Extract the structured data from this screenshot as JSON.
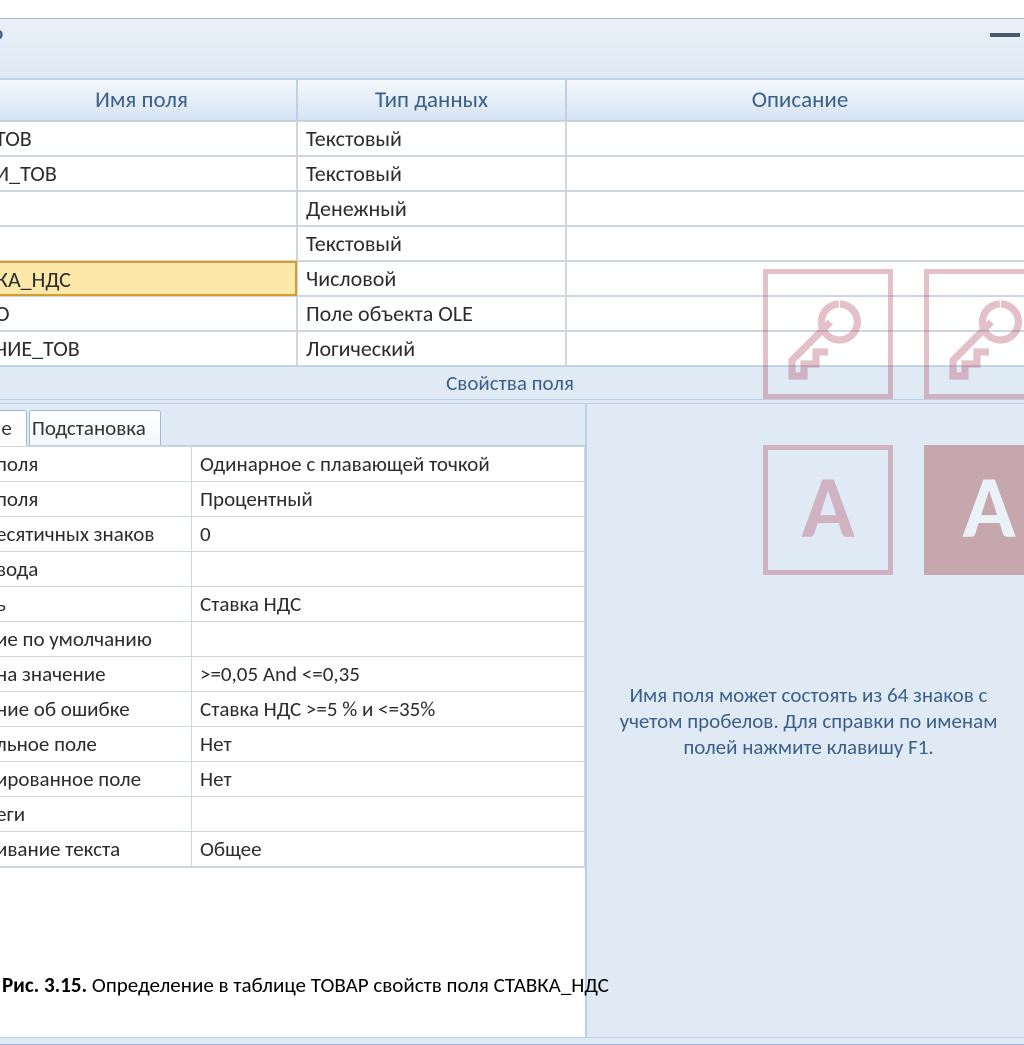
{
  "window": {
    "title_fragment": "Р"
  },
  "grid": {
    "headers": {
      "name": "Имя поля",
      "type": "Тип данных",
      "desc": "Описание"
    },
    "rows": [
      {
        "name": "ТОВ",
        "type": "Текстовый",
        "desc": "",
        "selected": false
      },
      {
        "name": "И_ТОВ",
        "type": "Текстовый",
        "desc": "",
        "selected": false
      },
      {
        "name": "",
        "type": "Денежный",
        "desc": "",
        "selected": false
      },
      {
        "name": "",
        "type": "Текстовый",
        "desc": "",
        "selected": false
      },
      {
        "name": "КА_НДС",
        "type": "Числовой",
        "desc": "",
        "selected": true
      },
      {
        "name": "О",
        "type": "Поле объекта OLE",
        "desc": "",
        "selected": false
      },
      {
        "name": "ЧИЕ_ТОВ",
        "type": "Логический",
        "desc": "",
        "selected": false
      }
    ],
    "separator": "Свойства поля"
  },
  "tabs": {
    "general": "ие",
    "lookup": "Подстановка"
  },
  "properties": [
    {
      "name": "поля",
      "value": "Одинарное с плавающей точкой"
    },
    {
      "name": "поля",
      "value": "Процентный"
    },
    {
      "name": "есятичных знаков",
      "value": "0"
    },
    {
      "name": "вода",
      "value": ""
    },
    {
      "name": "ь",
      "value": "Ставка НДС"
    },
    {
      "name": "ие по умолчанию",
      "value": ""
    },
    {
      "name": "на значение",
      "value": ">=0,05 And <=0,35"
    },
    {
      "name": "ние об ошибке",
      "value": "Ставка НДС >=5 % и <=35%"
    },
    {
      "name": "льное поле",
      "value": "Нет"
    },
    {
      "name": "ированное поле",
      "value": "Нет"
    },
    {
      "name": "еги",
      "value": ""
    },
    {
      "name": "ивание текста",
      "value": "Общее"
    }
  ],
  "hint_text": "Имя поля может состоять из 64 знаков с учетом пробелов. Для справки по именам полей нажмите клавишу F1.",
  "figure": {
    "caption_bold": "Рис. 3.15.",
    "caption_text": " Определение в таблице ТОВАР свойств поля СТАВКА_НДС"
  },
  "watermark_letter": "A"
}
